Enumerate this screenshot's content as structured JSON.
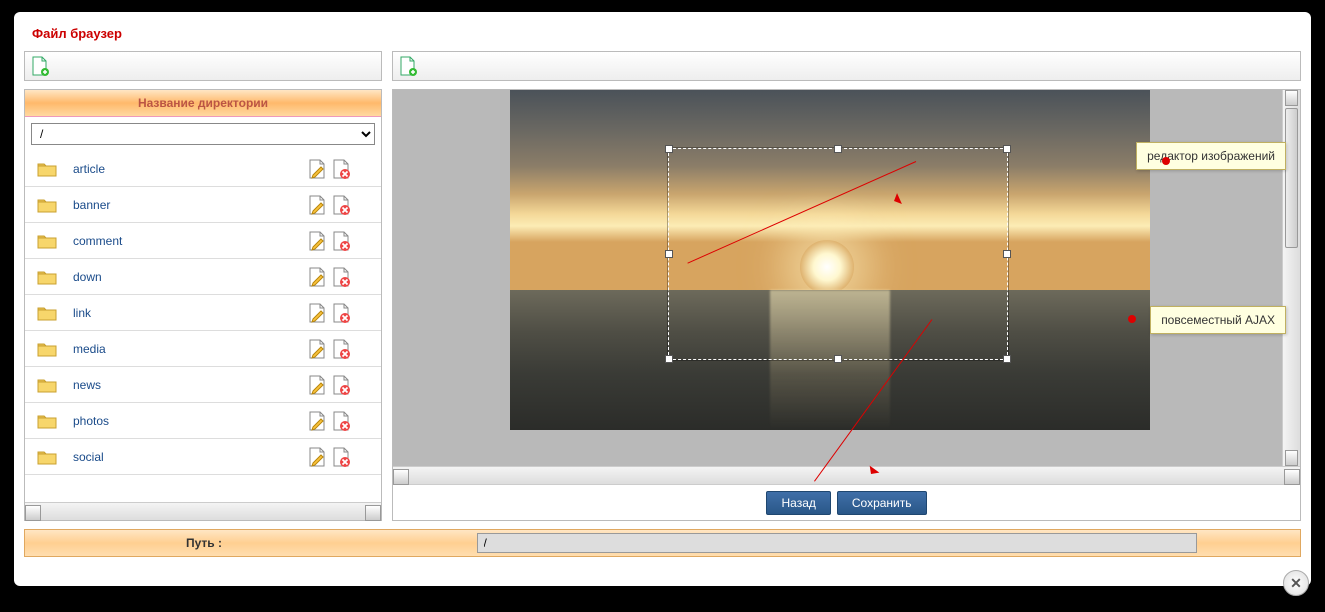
{
  "title": "Файл браузер",
  "dir_header": "Название директории",
  "current_dir": "/",
  "folders": [
    {
      "name": "article"
    },
    {
      "name": "banner"
    },
    {
      "name": "comment"
    },
    {
      "name": "down"
    },
    {
      "name": "link"
    },
    {
      "name": "media"
    },
    {
      "name": "news"
    },
    {
      "name": "photos"
    },
    {
      "name": "social"
    }
  ],
  "buttons": {
    "back": "Назад",
    "save": "Сохранить"
  },
  "footer": {
    "label": "Путь :",
    "value": "/"
  },
  "callouts": {
    "editor": "редактор изображений",
    "ajax": "повсеместный AJAX"
  },
  "icons": {
    "new_doc": "new-document-icon",
    "folder": "folder-icon",
    "edit": "edit-icon",
    "delete": "delete-icon"
  }
}
